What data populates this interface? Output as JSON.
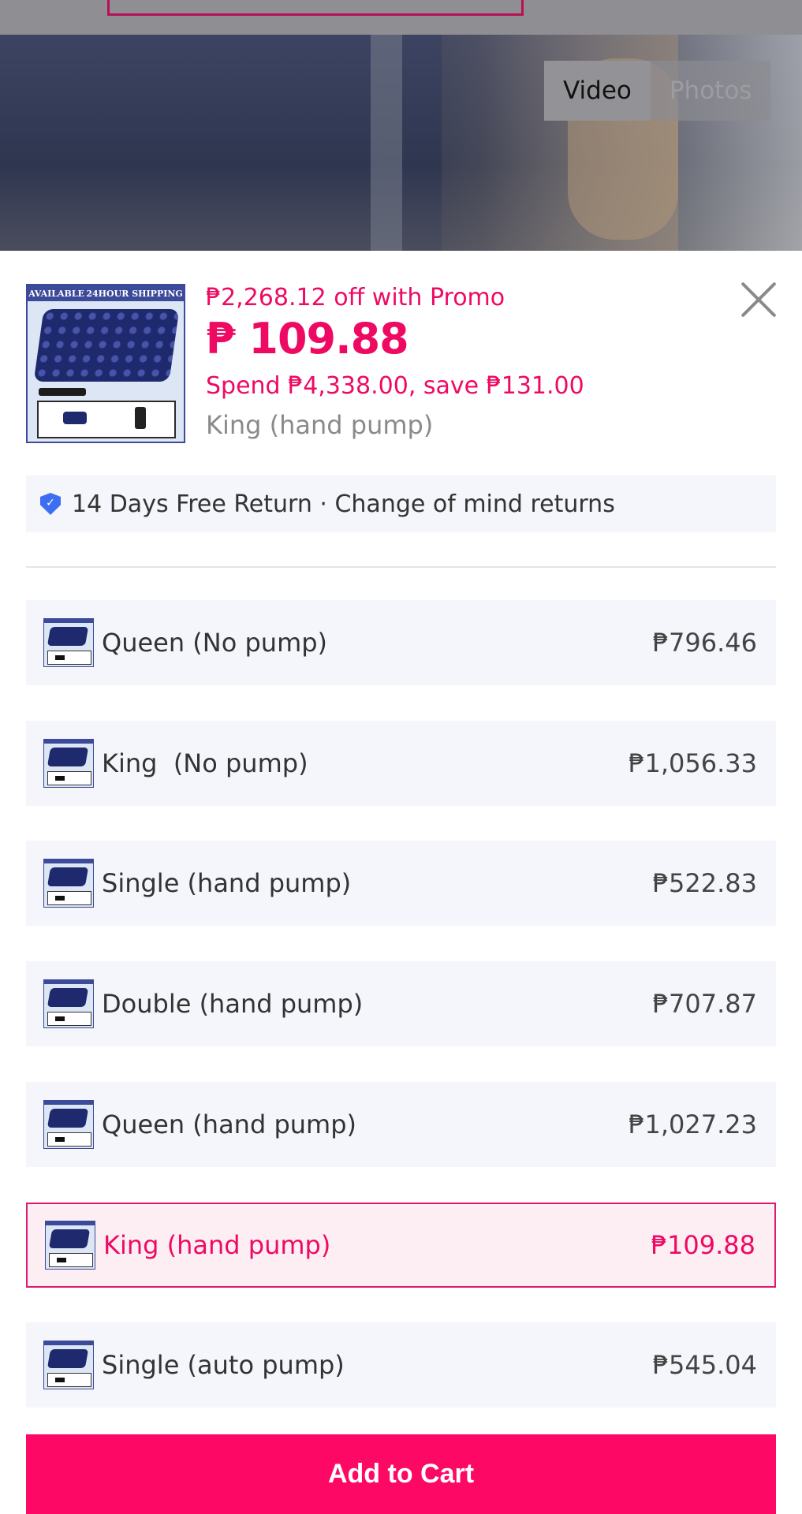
{
  "background": {
    "media_tabs": [
      {
        "label": "Video",
        "active": true
      },
      {
        "label": "Photos",
        "active": false
      }
    ]
  },
  "sheet": {
    "thumbnail": {
      "banner_left": "AVAILABLE",
      "banner_right": "24HOUR SHIPPING"
    },
    "promo_text": "₱2,268.12 off with Promo",
    "price": "₱ 109.88",
    "spend_text": "Spend ₱4,338.00, save ₱131.00",
    "selected_variant": "King (hand pump)",
    "close_icon": "close-icon",
    "return_policy": {
      "icon": "shield-check-icon",
      "text": "14 Days Free Return · Change of mind returns"
    },
    "variants": [
      {
        "name": "Queen (No pump)",
        "price": "₱796.46",
        "selected": false
      },
      {
        "name": "King  (No pump)",
        "price": "₱1,056.33",
        "selected": false
      },
      {
        "name": "Single (hand pump)",
        "price": "₱522.83",
        "selected": false
      },
      {
        "name": "Double (hand pump)",
        "price": "₱707.87",
        "selected": false
      },
      {
        "name": "Queen (hand pump)",
        "price": "₱1,027.23",
        "selected": false
      },
      {
        "name": "King (hand pump)",
        "price": "₱109.88",
        "selected": true
      },
      {
        "name": "Single (auto pump)",
        "price": "₱545.04",
        "selected": false
      }
    ],
    "add_to_cart_label": "Add to Cart"
  },
  "colors": {
    "accent": "#ee0a63",
    "button": "#fe0865",
    "row_bg": "#f4f6fb",
    "selected_row_bg": "#fdeef3"
  }
}
